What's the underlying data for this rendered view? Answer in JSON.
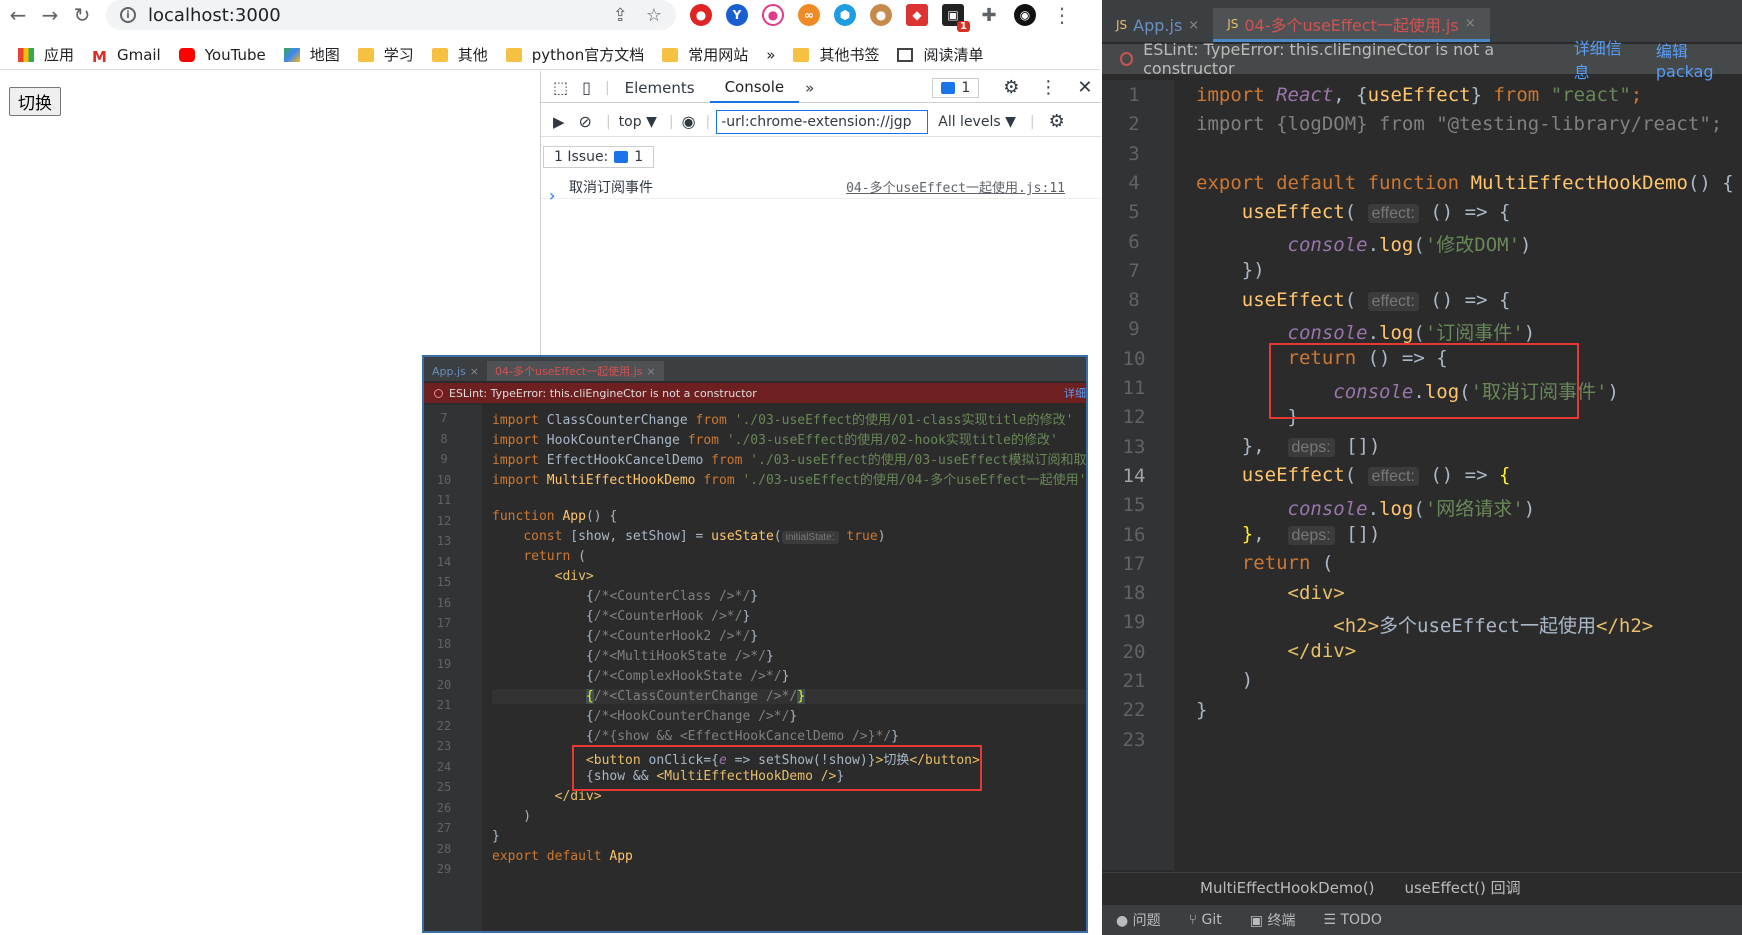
{
  "browser": {
    "url": "localhost:3000",
    "bookmarks": [
      "应用",
      "Gmail",
      "YouTube",
      "地图",
      "学习",
      "其他",
      "python官方文档",
      "常用网站",
      "»",
      "其他书签",
      "阅读清单"
    ],
    "page_button": "切换",
    "ext_badge": "1"
  },
  "devtools": {
    "tabs": [
      "Elements",
      "Console",
      "»"
    ],
    "msg_count": "1",
    "context": "top ▼",
    "filter_value": "-url:chrome-extension://jgp",
    "levels": "All levels ▼",
    "issues_label": "1 Issue:",
    "issues_count": "1",
    "log_text": "取消订阅事件",
    "log_source": "04-多个useEffect一起使用.js:11",
    "prompt": "›"
  },
  "ide": {
    "tabs": [
      "App.js",
      "04-多个useEffect一起使用.js"
    ],
    "eslint": "ESLint: TypeError: this.cliEngineCtor is not a constructor",
    "eslint_link1": "详细信息",
    "eslint_link2": "编辑 packag",
    "line_numbers": [
      "1",
      "2",
      "3",
      "4",
      "5",
      "6",
      "7",
      "8",
      "9",
      "10",
      "11",
      "12",
      "13",
      "14",
      "15",
      "16",
      "17",
      "18",
      "19",
      "20",
      "21",
      "22",
      "23"
    ],
    "breadcrumb": [
      "MultiEffectHookDemo()",
      "useEffect() 回调"
    ],
    "status": [
      "问题",
      "Git",
      "终端",
      "TODO"
    ]
  },
  "ide_small": {
    "tabs": [
      "App.js",
      "04-多个useEffect一起使用.js"
    ],
    "eslint": "ESLint: TypeError: this.cliEngineCtor is not a constructor",
    "eslint_link": "详细",
    "line_numbers": [
      "7",
      "8",
      "9",
      "10",
      "11",
      "12",
      "13",
      "14",
      "15",
      "16",
      "17",
      "18",
      "19",
      "20",
      "21",
      "22",
      "23",
      "24",
      "25",
      "26",
      "27",
      "28",
      "29"
    ]
  },
  "colors": {
    "keyword": "#cc7832",
    "function": "#ffc66d",
    "string": "#6a8759",
    "highlight_box": "#e53935"
  }
}
